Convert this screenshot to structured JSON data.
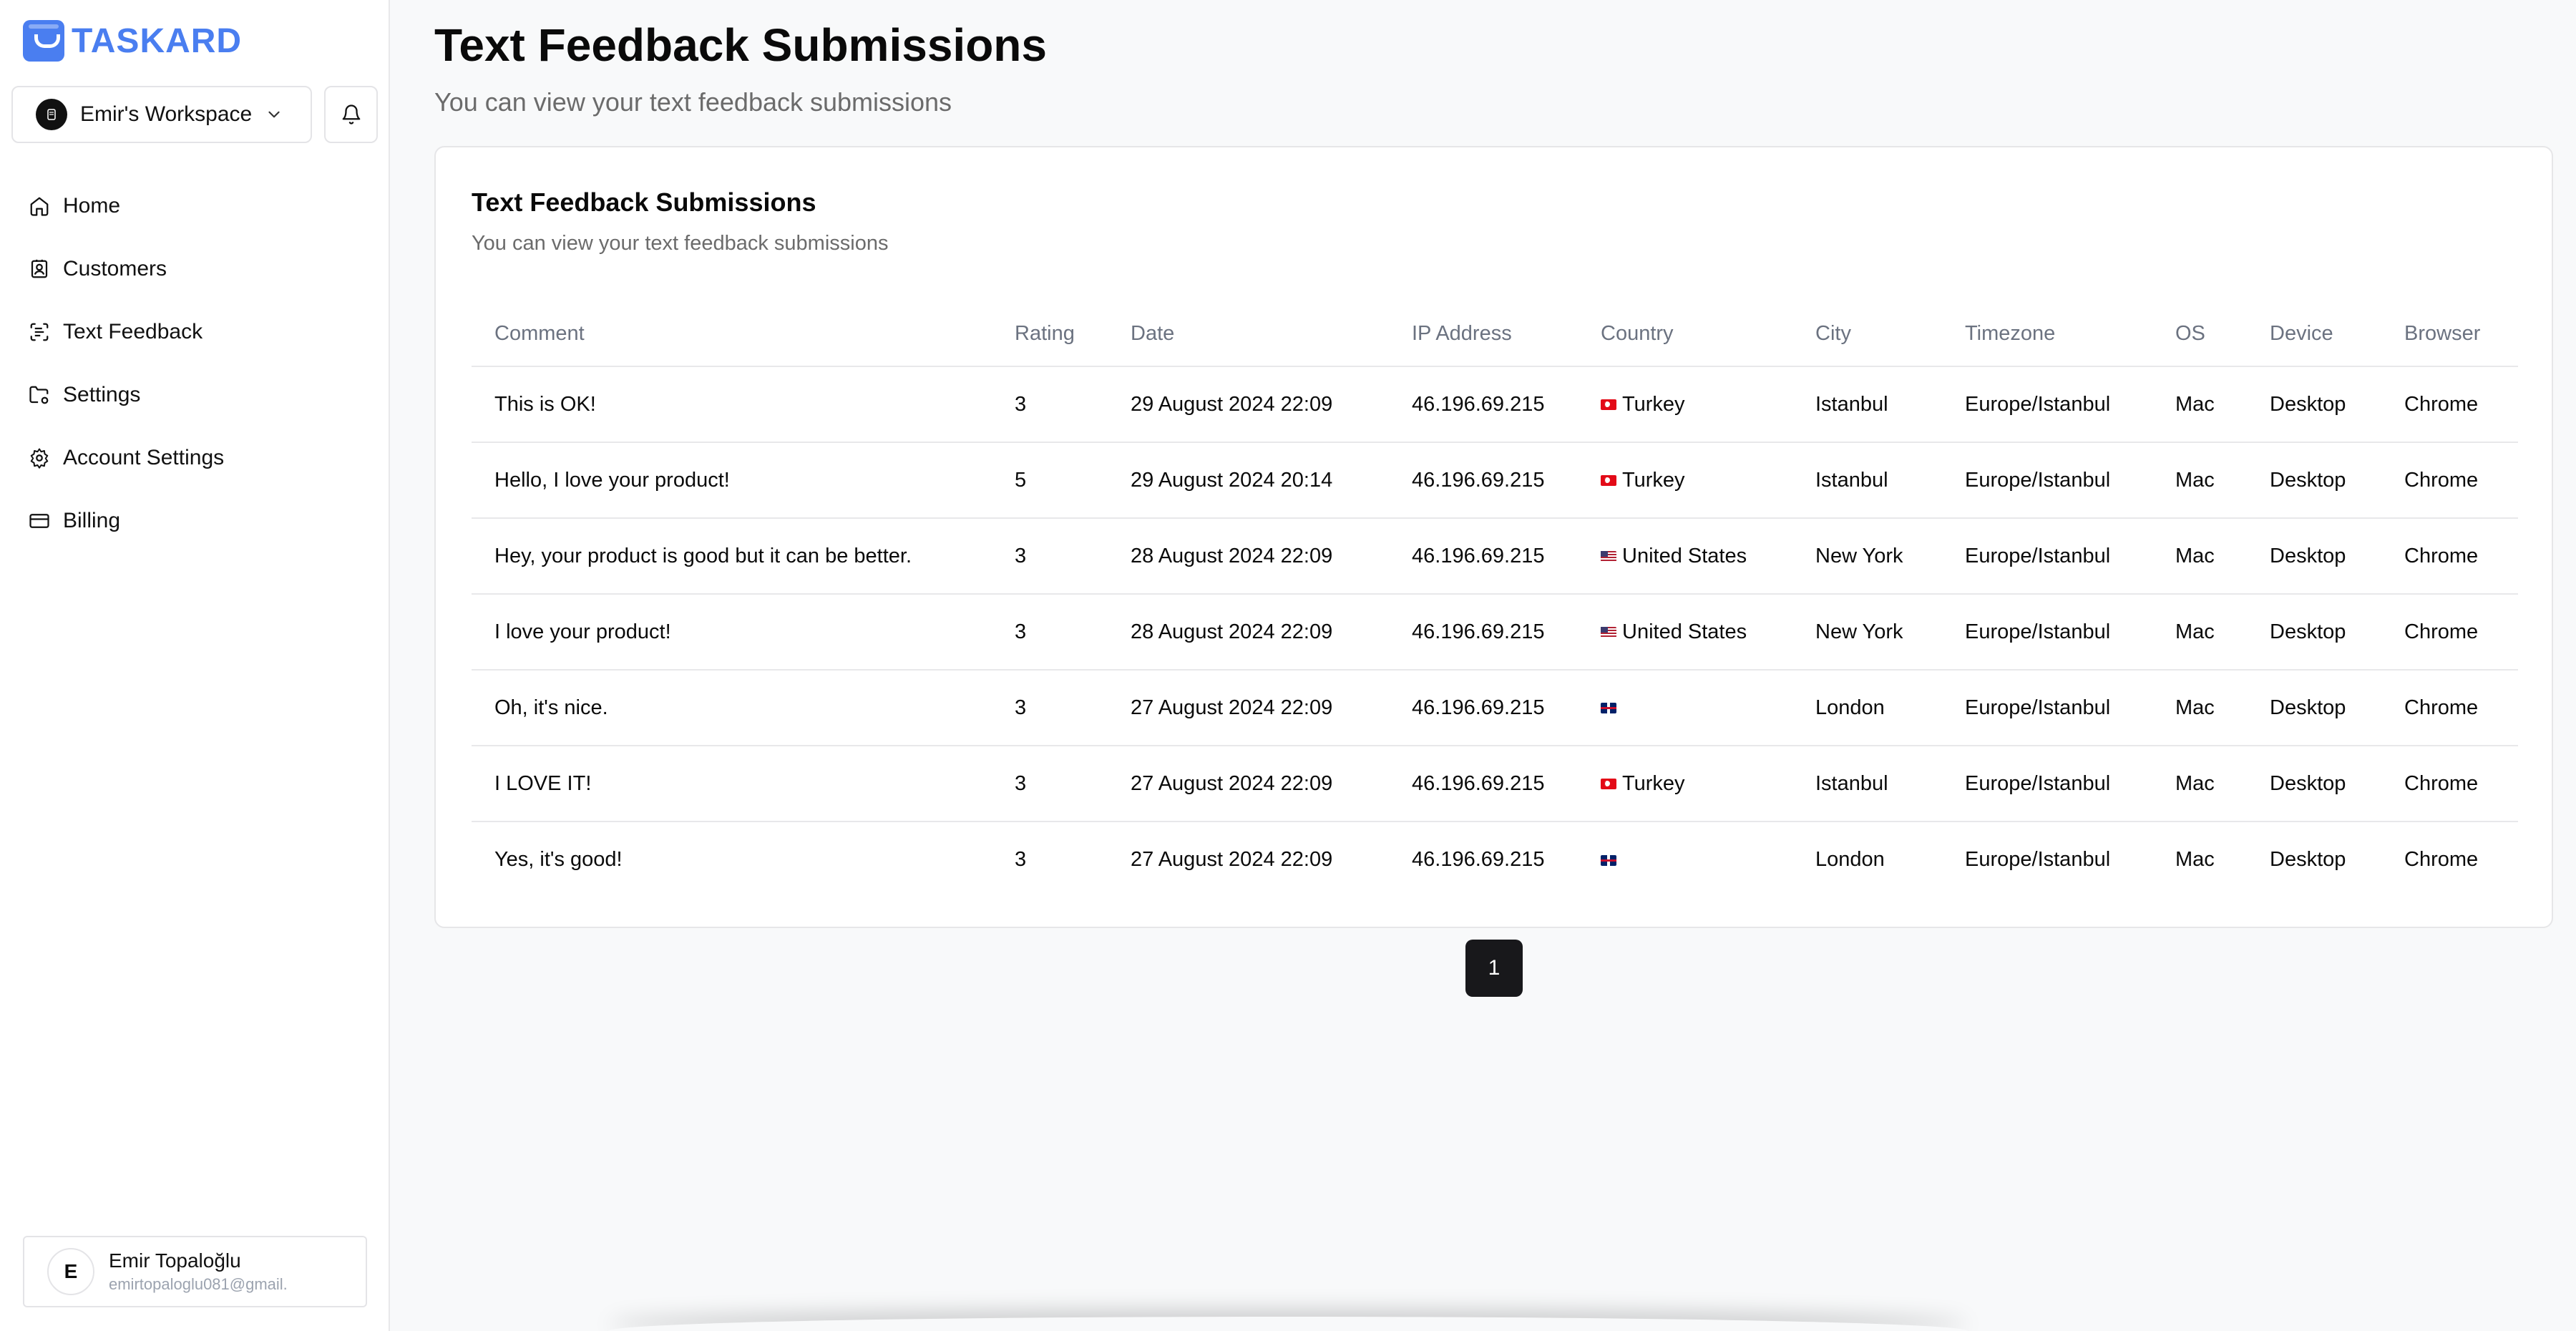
{
  "brand": {
    "name": "TASKARD",
    "color": "#4a7ef0"
  },
  "workspace": {
    "name": "Emir's Workspace"
  },
  "nav": [
    {
      "label": "Home",
      "icon": "home-icon"
    },
    {
      "label": "Customers",
      "icon": "contact-icon"
    },
    {
      "label": "Text Feedback",
      "icon": "scan-text-icon"
    },
    {
      "label": "Settings",
      "icon": "folder-cog-icon"
    },
    {
      "label": "Account Settings",
      "icon": "gear-icon"
    },
    {
      "label": "Billing",
      "icon": "credit-card-icon"
    }
  ],
  "user": {
    "initial": "E",
    "name": "Emir Topaloğlu",
    "email": "emirtopaloglu081@gmail."
  },
  "page": {
    "title": "Text Feedback Submissions",
    "subtitle": "You can view your text feedback submissions"
  },
  "card": {
    "title": "Text Feedback Submissions",
    "subtitle": "You can view your text feedback submissions"
  },
  "table": {
    "columns": [
      "Comment",
      "Rating",
      "Date",
      "IP Address",
      "Country",
      "City",
      "Timezone",
      "OS",
      "Device",
      "Browser"
    ],
    "rows": [
      {
        "comment": "This is OK!",
        "rating": "3",
        "date": "29 August 2024 22:09",
        "ip": "46.196.69.215",
        "flag": "tr",
        "country": "Turkey",
        "city": "Istanbul",
        "timezone": "Europe/Istanbul",
        "os": "Mac",
        "device": "Desktop",
        "browser": "Chrome"
      },
      {
        "comment": "Hello, I love your product!",
        "rating": "5",
        "date": "29 August 2024 20:14",
        "ip": "46.196.69.215",
        "flag": "tr",
        "country": "Turkey",
        "city": "Istanbul",
        "timezone": "Europe/Istanbul",
        "os": "Mac",
        "device": "Desktop",
        "browser": "Chrome"
      },
      {
        "comment": "Hey, your product is good but it can be better.",
        "rating": "3",
        "date": "28 August 2024 22:09",
        "ip": "46.196.69.215",
        "flag": "us",
        "country": "United States",
        "city": "New York",
        "timezone": "Europe/Istanbul",
        "os": "Mac",
        "device": "Desktop",
        "browser": "Chrome"
      },
      {
        "comment": "I love your product!",
        "rating": "3",
        "date": "28 August 2024 22:09",
        "ip": "46.196.69.215",
        "flag": "us",
        "country": "United States",
        "city": "New York",
        "timezone": "Europe/Istanbul",
        "os": "Mac",
        "device": "Desktop",
        "browser": "Chrome"
      },
      {
        "comment": "Oh, it's nice.",
        "rating": "3",
        "date": "27 August 2024 22:09",
        "ip": "46.196.69.215",
        "flag": "gb",
        "country": "",
        "city": "London",
        "timezone": "Europe/Istanbul",
        "os": "Mac",
        "device": "Desktop",
        "browser": "Chrome"
      },
      {
        "comment": "I LOVE IT!",
        "rating": "3",
        "date": "27 August 2024 22:09",
        "ip": "46.196.69.215",
        "flag": "tr",
        "country": "Turkey",
        "city": "Istanbul",
        "timezone": "Europe/Istanbul",
        "os": "Mac",
        "device": "Desktop",
        "browser": "Chrome"
      },
      {
        "comment": "Yes, it's good!",
        "rating": "3",
        "date": "27 August 2024 22:09",
        "ip": "46.196.69.215",
        "flag": "gb",
        "country": "",
        "city": "London",
        "timezone": "Europe/Istanbul",
        "os": "Mac",
        "device": "Desktop",
        "browser": "Chrome"
      }
    ]
  },
  "pagination": {
    "current": "1"
  }
}
